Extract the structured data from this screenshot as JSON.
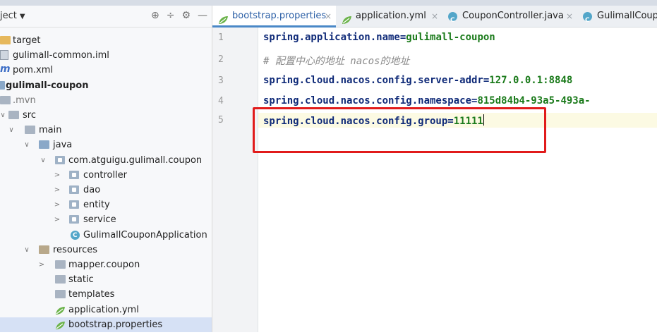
{
  "project_panel": {
    "title": "ject",
    "tools": [
      "⊕",
      "÷",
      "⚙",
      "—"
    ]
  },
  "tree": [
    {
      "label": "target",
      "icon": "folder-yellow-icon",
      "indent": 0,
      "twisty": ""
    },
    {
      "label": "gulimall-common.iml",
      "icon": "iml-file-icon",
      "indent": 0,
      "twisty": ""
    },
    {
      "label": "pom.xml",
      "icon": "maven-icon",
      "indent": 0,
      "twisty": ""
    },
    {
      "label": "gulimall-coupon",
      "icon": "module-icon",
      "indent": 0,
      "twisty": ""
    },
    {
      "label": ".mvn",
      "icon": "folder-icon",
      "indent": 0,
      "twisty": ""
    },
    {
      "label": "src",
      "icon": "folder-icon",
      "indent": 0,
      "twisty": "∨"
    },
    {
      "label": "main",
      "icon": "folder-icon",
      "indent": 1,
      "twisty": "∨"
    },
    {
      "label": "java",
      "icon": "source-folder-icon",
      "indent": 2,
      "twisty": "∨"
    },
    {
      "label": "com.atguigu.gulimall.coupon",
      "icon": "package-icon",
      "indent": 3,
      "twisty": "∨"
    },
    {
      "label": "controller",
      "icon": "package-icon",
      "indent": 4,
      "twisty": ">"
    },
    {
      "label": "dao",
      "icon": "package-icon",
      "indent": 4,
      "twisty": ">"
    },
    {
      "label": "entity",
      "icon": "package-icon",
      "indent": 4,
      "twisty": ">"
    },
    {
      "label": "service",
      "icon": "package-icon",
      "indent": 4,
      "twisty": ">"
    },
    {
      "label": "GulimallCouponApplication",
      "icon": "class-icon",
      "indent": 4,
      "twisty": ""
    },
    {
      "label": "resources",
      "icon": "resources-folder-icon",
      "indent": 2,
      "twisty": "∨"
    },
    {
      "label": "mapper.coupon",
      "icon": "folder-icon",
      "indent": 3,
      "twisty": ">"
    },
    {
      "label": "static",
      "icon": "folder-icon",
      "indent": 3,
      "twisty": ""
    },
    {
      "label": "templates",
      "icon": "folder-icon",
      "indent": 3,
      "twisty": ""
    },
    {
      "label": "application.yml",
      "icon": "spring-leaf-icon",
      "indent": 3,
      "twisty": ""
    },
    {
      "label": "bootstrap.properties",
      "icon": "spring-leaf-icon",
      "indent": 3,
      "twisty": "",
      "selected": true
    }
  ],
  "tabs": [
    {
      "label": "bootstrap.properties",
      "icon": "spring-leaf-icon",
      "active": true
    },
    {
      "label": "application.yml",
      "icon": "spring-leaf-icon",
      "active": false
    },
    {
      "label": "CouponController.java",
      "icon": "class-icon",
      "active": false
    },
    {
      "label": "GulimallCoup",
      "icon": "class-icon",
      "active": false
    }
  ],
  "close_glyph": "×",
  "editor": {
    "line_numbers": [
      "1",
      "2",
      "3",
      "4",
      "5"
    ],
    "lines": [
      {
        "key": "spring.application.name=",
        "value": "gulimall-coupon"
      },
      {
        "comment": "# 配置中心的地址 nacos的地址"
      },
      {
        "key": "spring.cloud.nacos.config.server-addr=",
        "value": "127.0.0.1:8848"
      },
      {
        "key": "spring.cloud.nacos.config.namespace=",
        "value": "815d84b4-93a5-493a-"
      },
      {
        "key": "spring.cloud.nacos.config.group=",
        "value": "11111"
      }
    ],
    "current_line": 5
  },
  "colors": {
    "key": "#0f2a78",
    "value": "#1a7a1a",
    "highlight_box": "#e11b1b",
    "selection": "#d6e1f5"
  }
}
